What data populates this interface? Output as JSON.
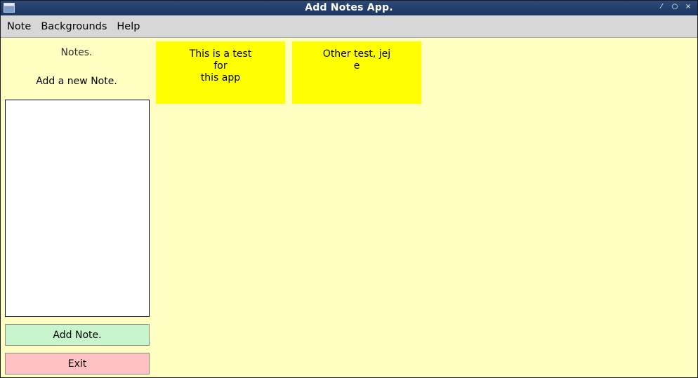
{
  "window": {
    "title": "Add Notes App.",
    "controls": {
      "min": "⁄",
      "max": "∘",
      "close": "x"
    }
  },
  "menu": {
    "items": [
      "Note",
      "Backgrounds",
      "Help"
    ]
  },
  "sidebar": {
    "notes_heading": "Notes.",
    "add_heading": "Add a new Note.",
    "input_value": "",
    "add_button": "Add Note.",
    "exit_button": "Exit"
  },
  "notes": [
    {
      "text": "This is a test\nfor\nthis app"
    },
    {
      "text": "Other test, jej\ne"
    }
  ],
  "colors": {
    "background": "#ffffc2",
    "note": "#ffff00",
    "add_button": "#c9f5cd",
    "exit_button": "#ffc1c1",
    "titlebar": "#1f3a66"
  }
}
